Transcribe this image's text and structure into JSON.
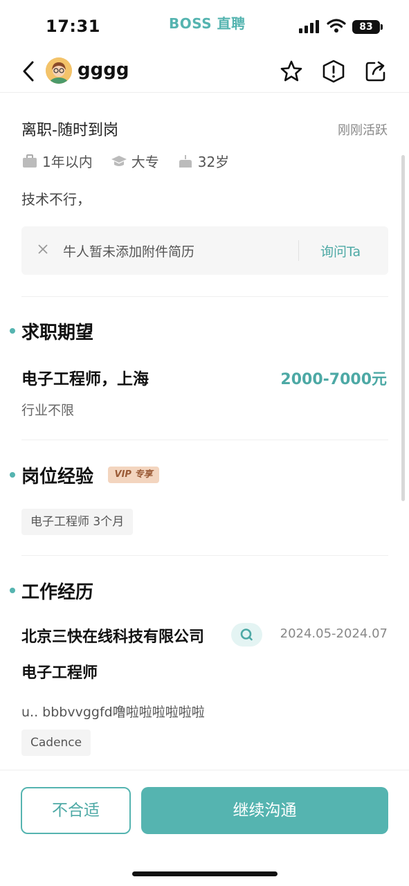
{
  "status_bar": {
    "time": "17:31",
    "app_name": "BOSS 直聘",
    "battery": "83"
  },
  "header": {
    "username": "gggg",
    "icons": [
      "back-icon",
      "star-icon",
      "report-icon",
      "share-icon"
    ]
  },
  "profile": {
    "status": "离职-随时到岗",
    "active": "刚刚活跃",
    "experience": "1年以内",
    "education": "大专",
    "age": "32岁",
    "intro": "技术不行，",
    "attachment_text": "牛人暂未添加附件简历",
    "attachment_ask": "询问Ta"
  },
  "expectation": {
    "title": "求职期望",
    "job": "电子工程师，上海",
    "salary": "2000-7000元",
    "industry": "行业不限"
  },
  "position_experience": {
    "title": "岗位经验",
    "vip_badge": "VIP 专享",
    "tags": [
      "电子工程师 3个月"
    ]
  },
  "work_history": {
    "title": "工作经历",
    "company": "北京三快在线科技有限公司",
    "period": "2024.05-2024.07",
    "position": "电子工程师",
    "description": "u.. bbbvvggfd噜啦啦啦啦啦啦",
    "skills": [
      "Cadence"
    ]
  },
  "actions": {
    "reject": "不合适",
    "continue": "继续沟通"
  },
  "colors": {
    "accent": "#55b4b0",
    "accent_text": "#4da9a5"
  }
}
